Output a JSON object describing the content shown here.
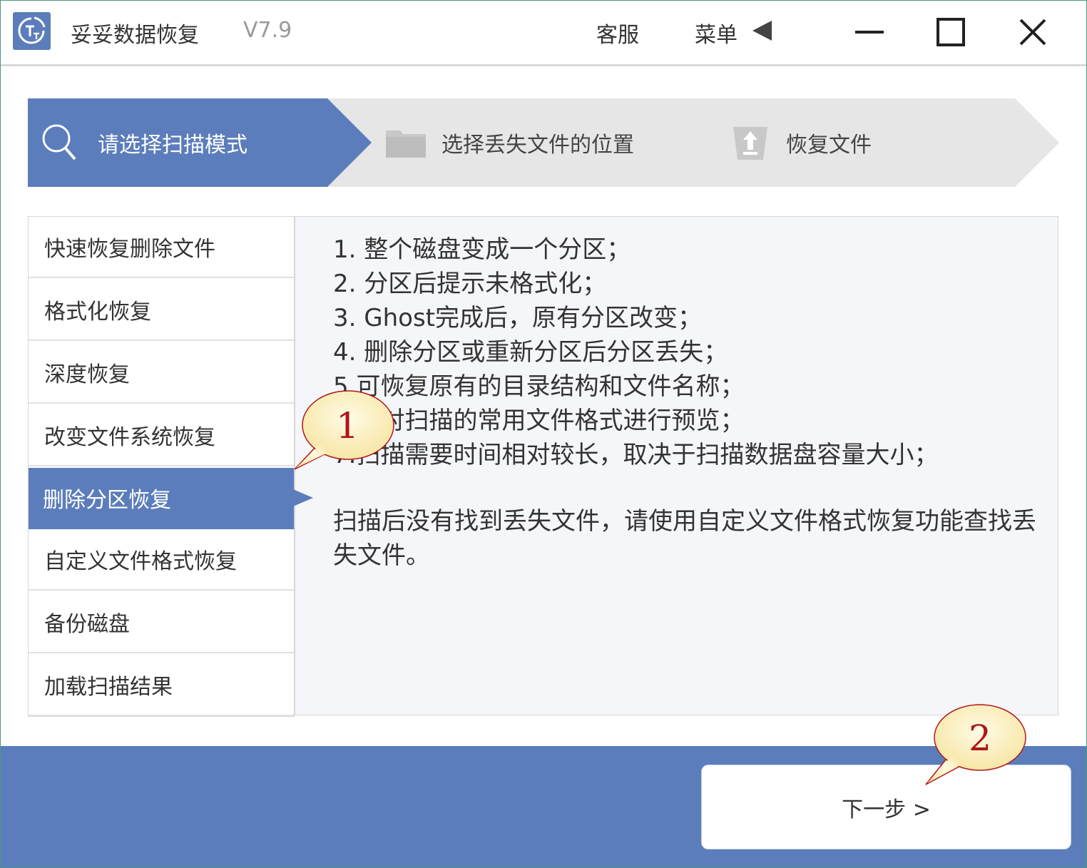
{
  "app": {
    "title": "妥妥数据恢复",
    "version": "V7.9",
    "service_label": "客服",
    "menu_label": "菜单"
  },
  "steps": [
    {
      "label": "请选择扫描模式",
      "icon": "search-icon",
      "state": "active"
    },
    {
      "label": "选择丢失文件的位置",
      "icon": "folder-icon",
      "state": "inactive"
    },
    {
      "label": "恢复文件",
      "icon": "upload-icon",
      "state": "inactive"
    }
  ],
  "modes": [
    {
      "label": "快速恢复删除文件"
    },
    {
      "label": "格式化恢复"
    },
    {
      "label": "深度恢复"
    },
    {
      "label": "改变文件系统恢复"
    },
    {
      "label": "删除分区恢复",
      "selected": true
    },
    {
      "label": "自定义文件格式恢复"
    },
    {
      "label": "备份磁盘"
    },
    {
      "label": "加载扫描结果"
    }
  ],
  "description": {
    "lines": [
      "1. 整个磁盘变成一个分区；",
      "2. 分区后提示未格式化；",
      "3. Ghost完成后，原有分区改变；",
      "4. 删除分区或重新分区后分区丢失；",
      "5.可恢复原有的目录结构和文件名称；",
      "6.可对扫描的常用文件格式进行预览；",
      "7.扫描需要时间相对较长，取决于扫描数据盘容量大小；"
    ],
    "note": "扫描后没有找到丢失文件，请使用自定义文件格式恢复功能查找丢失文件。"
  },
  "next_button": {
    "label": "下一步 >"
  },
  "callouts": [
    {
      "number": "1"
    },
    {
      "number": "2"
    }
  ],
  "colors": {
    "accent": "#5b7dbb",
    "step_inactive": "#e6e6e6",
    "panel_bg": "#f5f6f9",
    "callout_fill": "#fdf3c4",
    "callout_text": "#b0151a"
  }
}
